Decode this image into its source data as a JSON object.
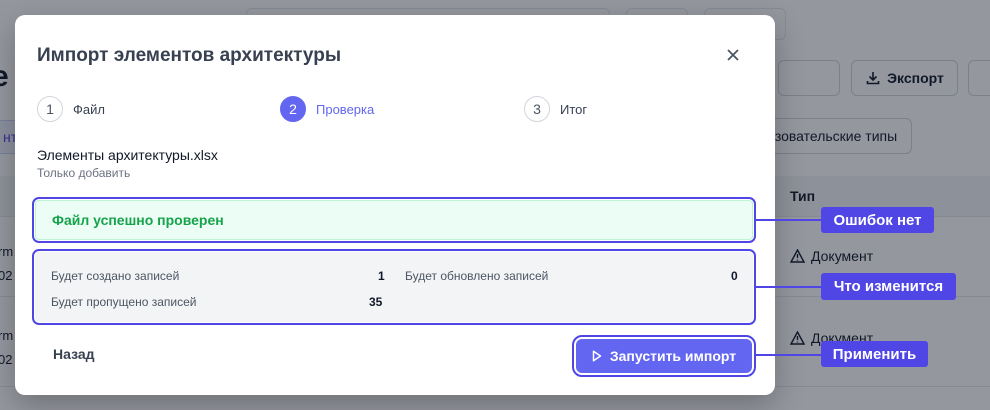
{
  "background": {
    "heading": "е",
    "export_label": "Экспорт",
    "tab_fragment": "нт",
    "types_label": "зовательские типы",
    "table_header_type": "Тип",
    "row1_type": "Документ",
    "row2_type": "Документ",
    "row1_left_a": "rm",
    "row1_left_b": "02",
    "row2_left_a": "rm",
    "row2_left_b": "02"
  },
  "modal": {
    "title": "Импорт элементов архитектуры",
    "steps": [
      {
        "number": "1",
        "label": "Файл"
      },
      {
        "number": "2",
        "label": "Проверка",
        "active": true
      },
      {
        "number": "3",
        "label": "Итог"
      }
    ],
    "file_name": "Элементы архитектуры.xlsx",
    "file_mode": "Только добавить",
    "success_message": "Файл успешно проверен",
    "stats": {
      "created_label": "Будет создано записей",
      "created_value": "1",
      "updated_label": "Будет обновлено записей",
      "updated_value": "0",
      "skipped_label": "Будет пропущено записей",
      "skipped_value": "35"
    },
    "back_label": "Назад",
    "run_label": "Запустить импорт"
  },
  "callouts": {
    "no_errors": "Ошибок нет",
    "what_changes": "Что изменится",
    "apply": "Применить"
  },
  "colors": {
    "accent": "#6366f1",
    "callout": "#4f46e5",
    "success_text": "#16a34a",
    "success_bg": "#ecfdf5"
  }
}
